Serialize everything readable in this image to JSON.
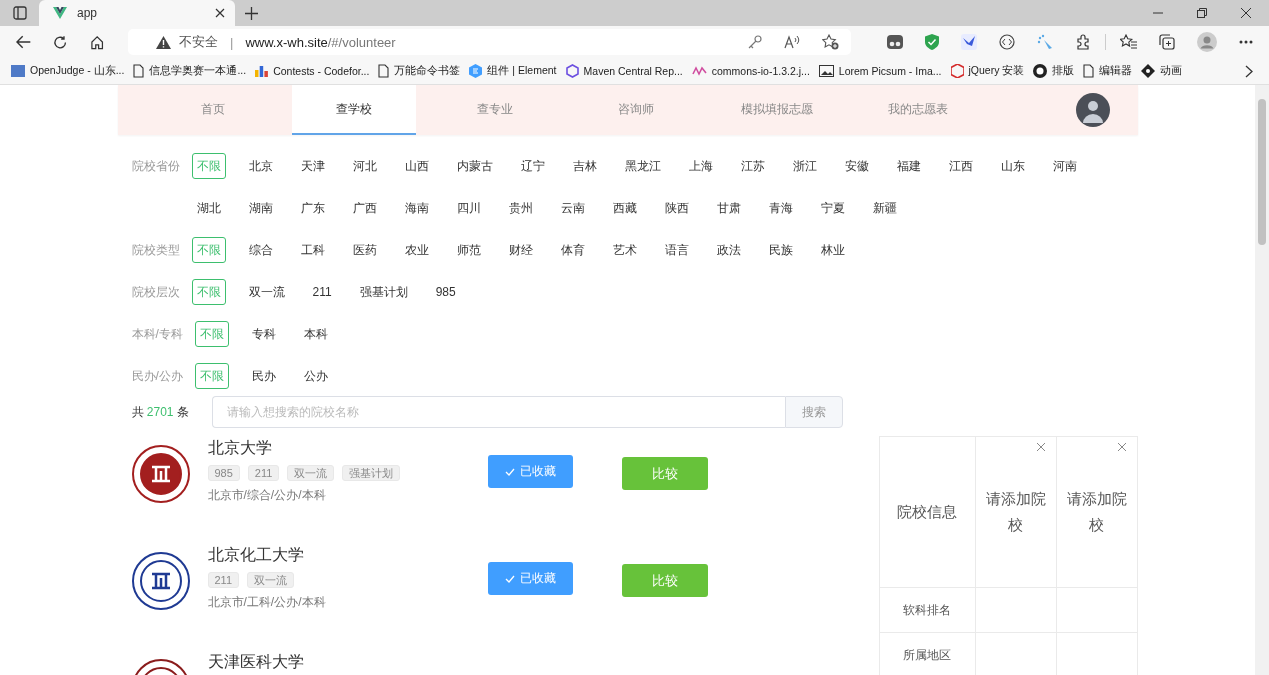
{
  "browser": {
    "tab": {
      "title": "app"
    },
    "address": {
      "security": "不安全",
      "separator": "|",
      "url_host": "www.x-wh.site",
      "url_path": "/#/volunteer"
    },
    "bookmarks": [
      {
        "label": "OpenJudge - 山东...",
        "kind": "poj"
      },
      {
        "label": "信息学奥赛一本通...",
        "kind": "page"
      },
      {
        "label": "Contests - Codefor...",
        "kind": "bars"
      },
      {
        "label": "万能命令书签",
        "kind": "page"
      },
      {
        "label": "组件 | Element",
        "kind": "element"
      },
      {
        "label": "Maven Central Rep...",
        "kind": "hex"
      },
      {
        "label": "commons-io-1.3.2.j...",
        "kind": "wave"
      },
      {
        "label": "Lorem Picsum - Ima...",
        "kind": "photo"
      },
      {
        "label": "jQuery 安装",
        "kind": "jquery"
      },
      {
        "label": "排版",
        "kind": "github"
      },
      {
        "label": "编辑器",
        "kind": "page"
      },
      {
        "label": "动画",
        "kind": "diamond"
      }
    ]
  },
  "nav": {
    "items": [
      {
        "label": "首页",
        "selected": false
      },
      {
        "label": "查学校",
        "selected": true
      },
      {
        "label": "查专业",
        "selected": false
      },
      {
        "label": "咨询师",
        "selected": false
      },
      {
        "label": "模拟填报志愿",
        "selected": false
      },
      {
        "label": "我的志愿表",
        "selected": false
      }
    ]
  },
  "filters": [
    {
      "label": "院校省份",
      "options": [
        {
          "label": "不限",
          "selected": true
        },
        {
          "label": "北京",
          "selected": false
        },
        {
          "label": "天津",
          "selected": false
        },
        {
          "label": "河北",
          "selected": false
        },
        {
          "label": "山西",
          "selected": false
        },
        {
          "label": "内蒙古",
          "selected": false
        },
        {
          "label": "辽宁",
          "selected": false
        },
        {
          "label": "吉林",
          "selected": false
        },
        {
          "label": "黑龙江",
          "selected": false
        },
        {
          "label": "上海",
          "selected": false
        },
        {
          "label": "江苏",
          "selected": false
        },
        {
          "label": "浙江",
          "selected": false
        },
        {
          "label": "安徽",
          "selected": false
        },
        {
          "label": "福建",
          "selected": false
        },
        {
          "label": "江西",
          "selected": false
        },
        {
          "label": "山东",
          "selected": false
        },
        {
          "label": "河南",
          "selected": false
        },
        {
          "label": "湖北",
          "selected": false
        },
        {
          "label": "湖南",
          "selected": false
        },
        {
          "label": "广东",
          "selected": false
        },
        {
          "label": "广西",
          "selected": false
        },
        {
          "label": "海南",
          "selected": false
        },
        {
          "label": "四川",
          "selected": false
        },
        {
          "label": "贵州",
          "selected": false
        },
        {
          "label": "云南",
          "selected": false
        },
        {
          "label": "西藏",
          "selected": false
        },
        {
          "label": "陕西",
          "selected": false
        },
        {
          "label": "甘肃",
          "selected": false
        },
        {
          "label": "青海",
          "selected": false
        },
        {
          "label": "宁夏",
          "selected": false
        },
        {
          "label": "新疆",
          "selected": false
        }
      ]
    },
    {
      "label": "院校类型",
      "options": [
        {
          "label": "不限",
          "selected": true
        },
        {
          "label": "综合",
          "selected": false
        },
        {
          "label": "工科",
          "selected": false
        },
        {
          "label": "医药",
          "selected": false
        },
        {
          "label": "农业",
          "selected": false
        },
        {
          "label": "师范",
          "selected": false
        },
        {
          "label": "财经",
          "selected": false
        },
        {
          "label": "体育",
          "selected": false
        },
        {
          "label": "艺术",
          "selected": false
        },
        {
          "label": "语言",
          "selected": false
        },
        {
          "label": "政法",
          "selected": false
        },
        {
          "label": "民族",
          "selected": false
        },
        {
          "label": "林业",
          "selected": false
        }
      ]
    },
    {
      "label": "院校层次",
      "options": [
        {
          "label": "不限",
          "selected": true
        },
        {
          "label": "双一流",
          "selected": false
        },
        {
          "label": "211",
          "selected": false
        },
        {
          "label": "强基计划",
          "selected": false
        },
        {
          "label": "985",
          "selected": false
        }
      ]
    },
    {
      "label": "本科/专科",
      "options": [
        {
          "label": "不限",
          "selected": true
        },
        {
          "label": "专科",
          "selected": false
        },
        {
          "label": "本科",
          "selected": false
        }
      ]
    },
    {
      "label": "民办/公办",
      "options": [
        {
          "label": "不限",
          "selected": true
        },
        {
          "label": "民办",
          "selected": false
        },
        {
          "label": "公办",
          "selected": false
        }
      ]
    }
  ],
  "search": {
    "count_prefix": "共",
    "count": "2701",
    "count_suffix": "条",
    "placeholder": "请输入想搜索的院校名称",
    "button": "搜索"
  },
  "universities": [
    {
      "name": "北京大学",
      "color": "#a31f1f",
      "tags": [
        "985",
        "211",
        "双一流",
        "强基计划"
      ],
      "meta": "北京市/综合/公办/本科",
      "favorite_label": "已收藏",
      "favorited": true,
      "compare_label": "比较"
    },
    {
      "name": "北京化工大学",
      "color": "#1f3a93",
      "tags": [
        "211",
        "双一流"
      ],
      "meta": "北京市/工科/公办/本科",
      "favorite_label": "已收藏",
      "favorited": true,
      "compare_label": "比较"
    },
    {
      "name": "天津医科大学",
      "color": "#8a1c1c"
    }
  ],
  "compare": {
    "header": "院校信息",
    "slots": [
      "请添加院校",
      "请添加院校"
    ],
    "rows": [
      "软科排名",
      "所属地区"
    ]
  }
}
